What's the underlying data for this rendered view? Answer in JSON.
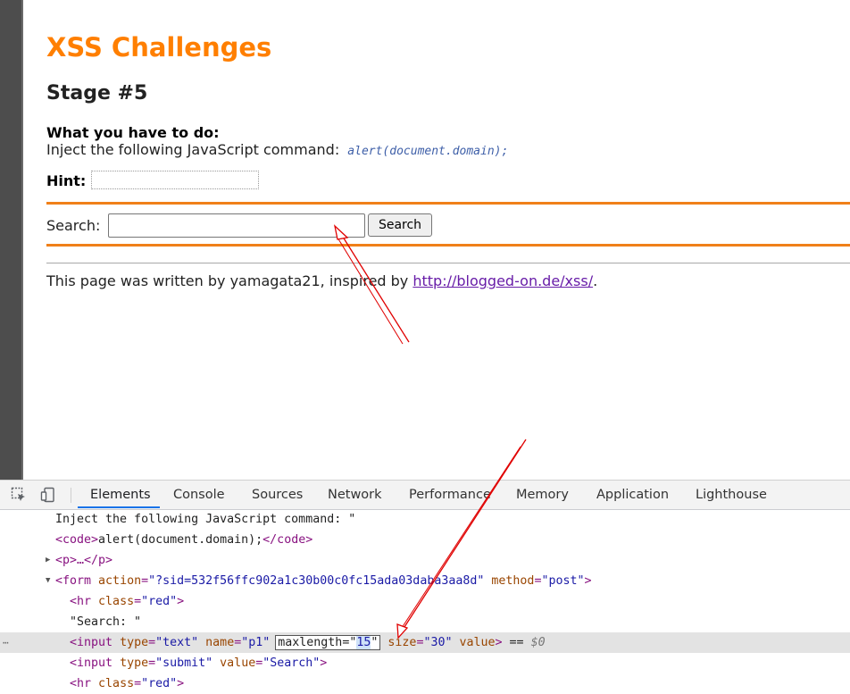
{
  "page": {
    "title": "XSS Challenges",
    "stage": "Stage #5",
    "task_heading": "What you have to do:",
    "task_text": "Inject the following JavaScript command:",
    "task_code": "alert(document.domain);",
    "hint_label": "Hint:",
    "search_label": "Search:",
    "search_value": "",
    "search_button": "Search",
    "footer_prefix": "This page was written by yamagata21, inspired by ",
    "footer_link": "http://blogged-on.de/xss/",
    "footer_suffix": "."
  },
  "devtools": {
    "tabs": [
      "Elements",
      "Console",
      "Sources",
      "Network",
      "Performance",
      "Memory",
      "Application",
      "Lighthouse"
    ],
    "active_tab": "Elements",
    "lines": {
      "l1_text": "Inject the following JavaScript command: \"",
      "l2_open": "<code>",
      "l2_text": "alert(document.domain);",
      "l2_close": "</code>",
      "l3": "<p>…</p>",
      "l4_tag": "<form",
      "l4_attr1": "action",
      "l4_val1": "\"?sid=532f56ffc902a1c30b00c0fc15ada03daba3aa8d\"",
      "l4_attr2": "method",
      "l4_val2": "\"post\"",
      "l4_end": ">",
      "l5_tag": "<hr",
      "l5_attr": "class",
      "l5_val": "\"red\"",
      "l5_end": ">",
      "l6_text": "\"Search: \"",
      "l7_tag": "<input",
      "l7_attr1": "type",
      "l7_val1": "\"text\"",
      "l7_attr2": "name",
      "l7_val2": "\"p1\"",
      "l7_attr3": "maxlength",
      "l7_q1": "\"",
      "l7_val3": "15",
      "l7_q2": "\"",
      "l7_attr4": "size",
      "l7_val4": "\"30\"",
      "l7_attr5": "value",
      "l7_end": ">",
      "l7_eq": " == ",
      "l7_dollar": "$0",
      "l8_tag": "<input",
      "l8_attr1": "type",
      "l8_val1": "\"submit\"",
      "l8_attr2": "value",
      "l8_val2": "\"Search\"",
      "l8_end": ">",
      "l9_tag": "<hr",
      "l9_attr": "class",
      "l9_val": "\"red\"",
      "l9_end": ">"
    }
  },
  "colors": {
    "title_orange": "#ff7f00",
    "rule_orange": "#f08019",
    "arrow_red": "#e00000",
    "devtools_accent": "#1a73e8"
  },
  "icons": [
    "inspect-element-icon",
    "device-toggle-icon",
    "arrow-annotation",
    "expand-triangle-icon"
  ]
}
